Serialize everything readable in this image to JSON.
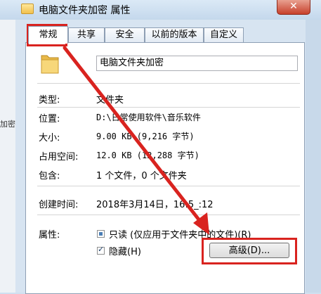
{
  "window": {
    "title": "电脑文件夹加密 属性",
    "close_label": "✕"
  },
  "left_fragment": "加密",
  "tabs": [
    {
      "label": "常规",
      "active": true
    },
    {
      "label": "共享",
      "active": false
    },
    {
      "label": "安全",
      "active": false
    },
    {
      "label": "以前的版本",
      "active": false
    },
    {
      "label": "自定义",
      "active": false
    }
  ],
  "general": {
    "folder_name": "电脑文件夹加密",
    "type_label": "类型:",
    "type_value": "文件夹",
    "location_label": "位置:",
    "location_value": "D:\\日常使用软件\\音乐软件",
    "size_label": "大小:",
    "size_value": "9.00 KB (9,216 字节)",
    "disk_size_label": "占用空间:",
    "disk_size_value": "12.0 KB (12,288 字节)",
    "contains_label": "包含:",
    "contains_value": "1 个文件，0 个文件夹",
    "created_label": "创建时间:",
    "created_value": "2018年3月14日，16:5_:12",
    "attributes_label": "属性:",
    "readonly_label": "只读 (仅应用于文件夹中的文件)(R)",
    "hidden_label": "隐藏(H)",
    "advanced_button": "高级(D)..."
  },
  "colors": {
    "annotation_red": "#d9231f",
    "panel_bg": "#ffffff",
    "frame_bg": "#d7e4f1"
  }
}
